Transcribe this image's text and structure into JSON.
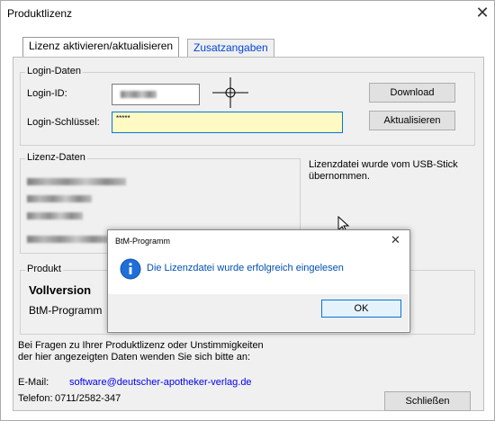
{
  "window": {
    "title": "Produktlizenz"
  },
  "tabs": [
    {
      "label": "Lizenz aktivieren/aktualisieren"
    },
    {
      "label": "Zusatzangaben"
    }
  ],
  "login": {
    "group_label": "Login-Daten",
    "id_label": "Login-ID:",
    "key_label": "Login-Schlüssel:",
    "key_value": "*****"
  },
  "buttons": {
    "download": "Download",
    "update": "Aktualisieren",
    "close": "Schließen",
    "ok": "OK"
  },
  "license_data": {
    "group_label": "Lizenz-Daten"
  },
  "usb_message": "Lizenzdatei wurde vom USB-Stick übernommen.",
  "product": {
    "group_label": "Produkt",
    "version": "Vollversion",
    "name": "BtM-Programm"
  },
  "contact": {
    "line1": "Bei Fragen zu Ihrer Produktlizenz oder Unstimmigkeiten",
    "line2": "der hier angezeigten Daten wenden Sie sich bitte an:",
    "email_label": "E-Mail:",
    "email": "software@deutscher-apotheker-verlag.de",
    "phone_label": "Telefon:",
    "phone": "0711/2582-347"
  },
  "dialog": {
    "title": "BtM-Programm",
    "message": "Die Lizenzdatei wurde erfolgreich eingelesen"
  },
  "colors": {
    "input_highlight": "#fff9c4",
    "info_icon": "#1e6fd9",
    "link": "#0000ee"
  }
}
